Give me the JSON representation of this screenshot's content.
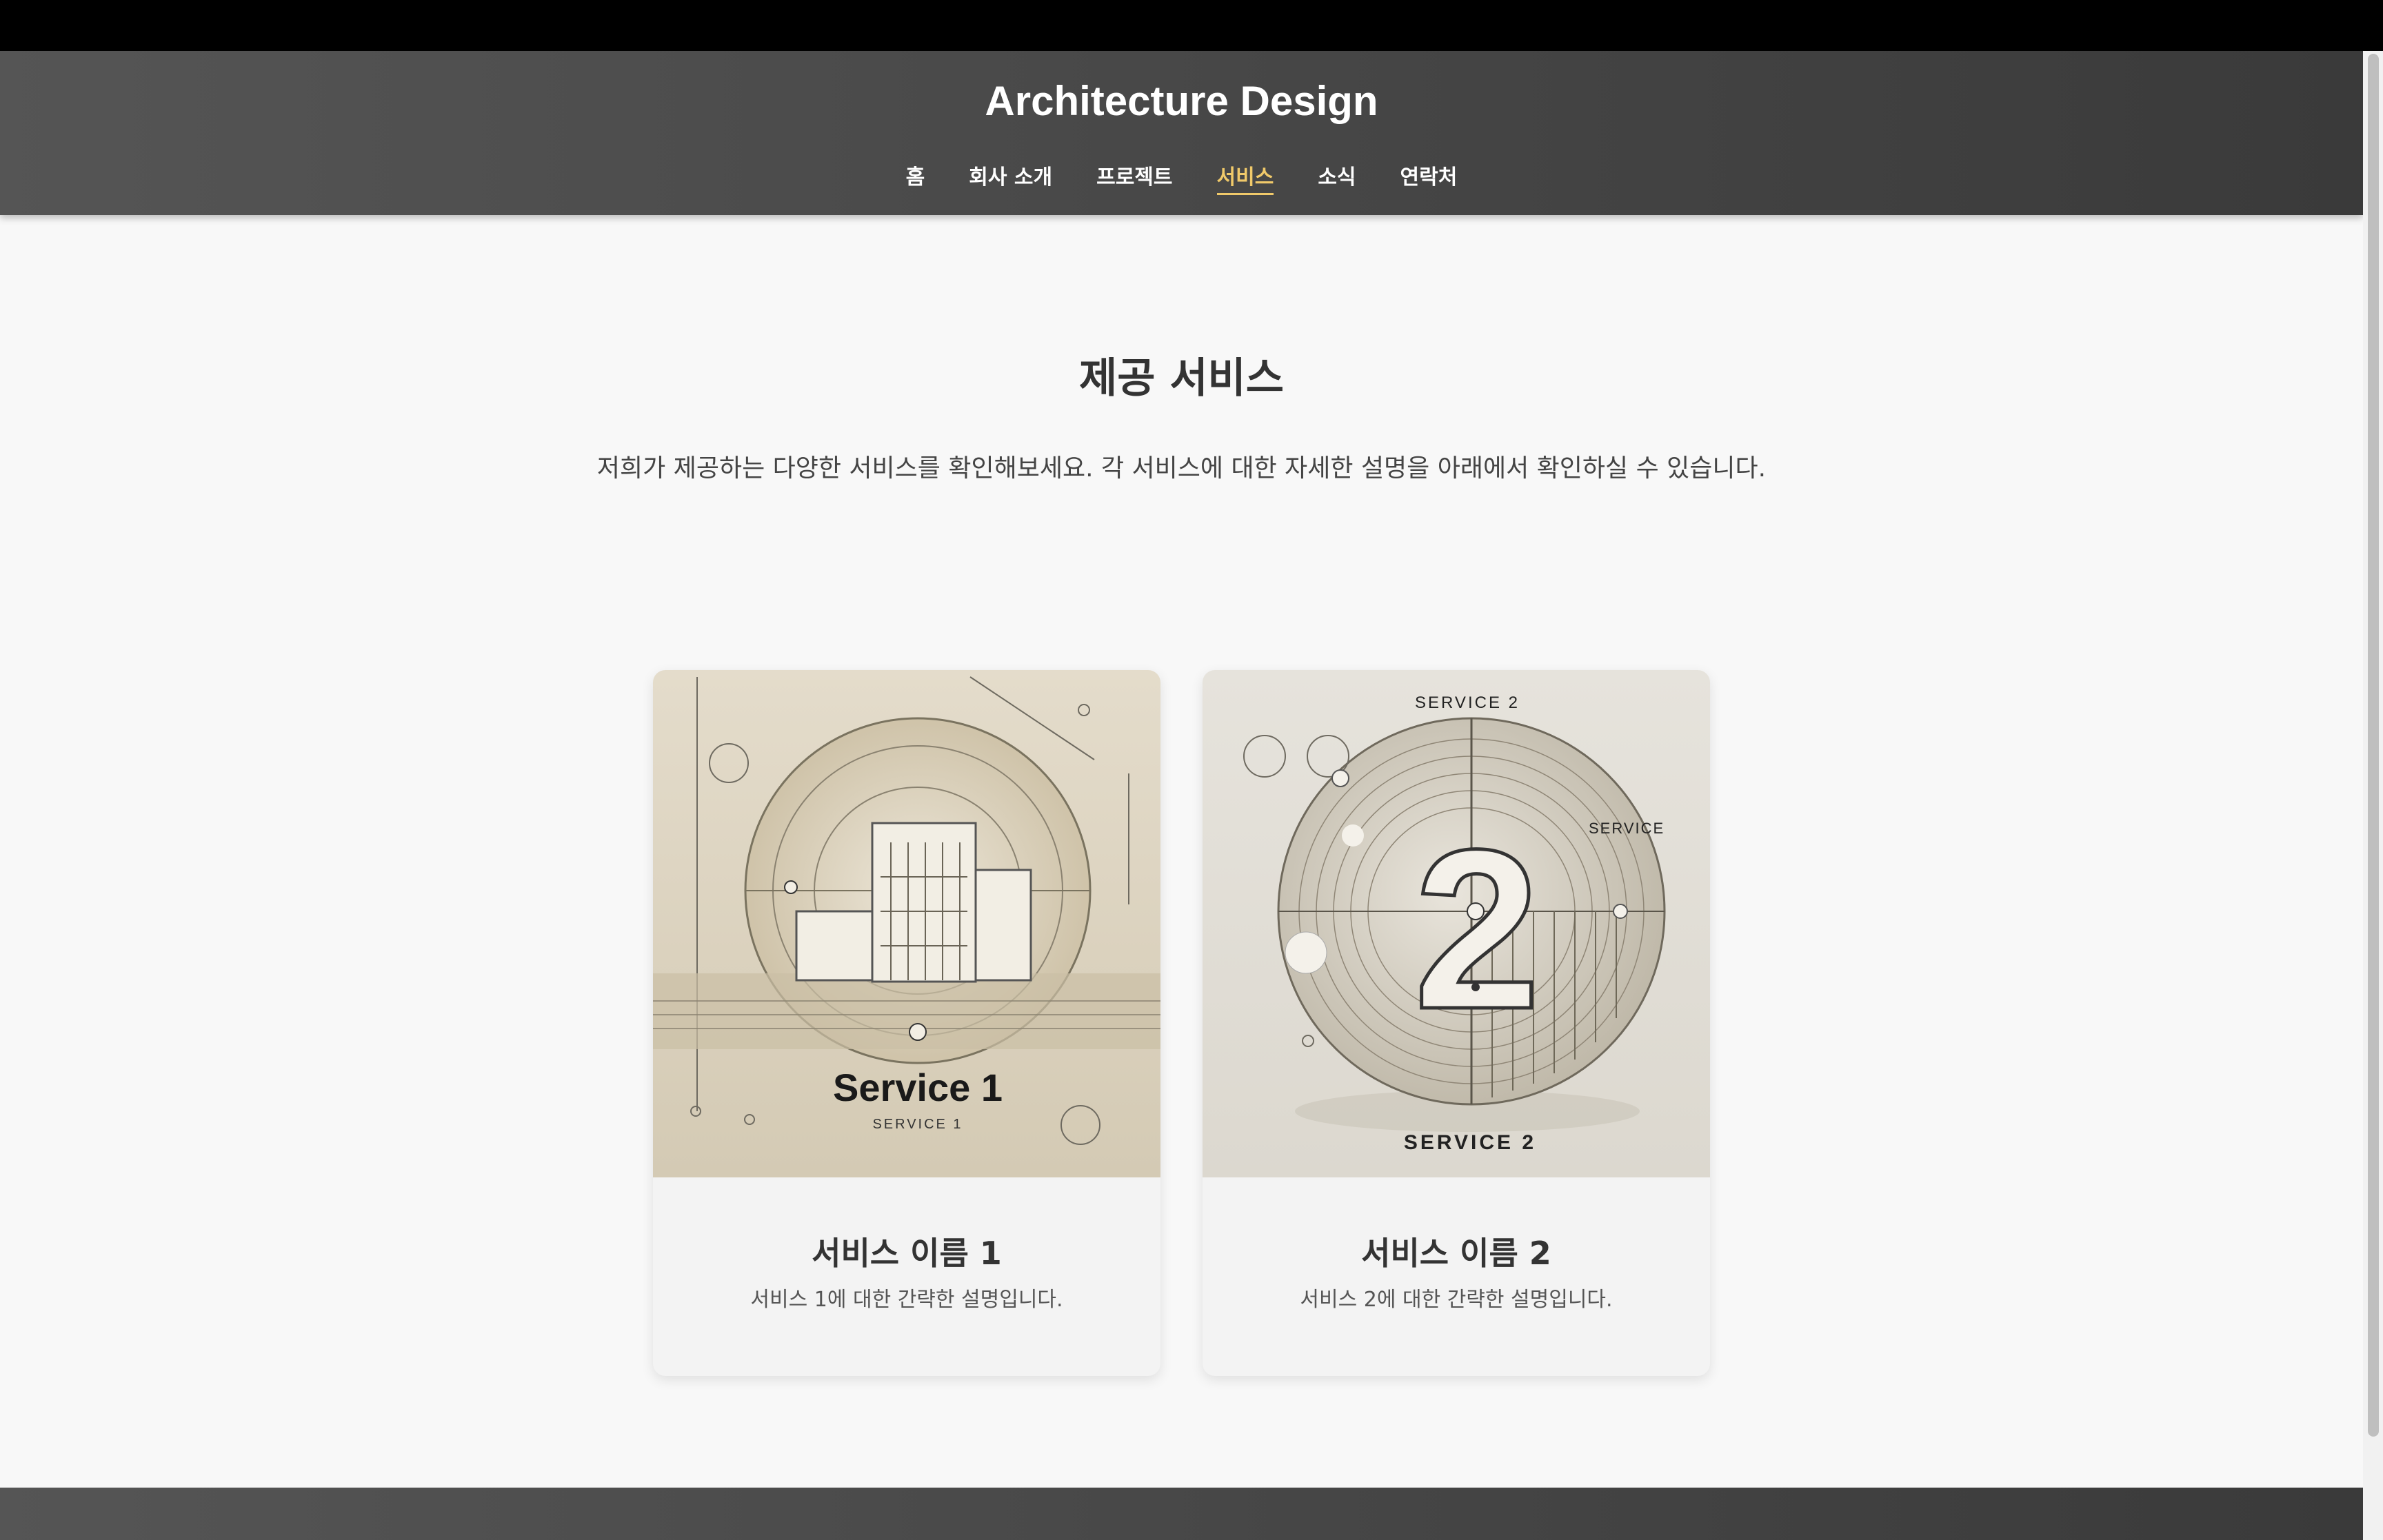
{
  "header": {
    "title": "Architecture Design",
    "nav": [
      {
        "label": "홈"
      },
      {
        "label": "회사 소개"
      },
      {
        "label": "프로젝트"
      },
      {
        "label": "서비스",
        "active": true
      },
      {
        "label": "소식"
      },
      {
        "label": "연락처"
      }
    ]
  },
  "main": {
    "heading": "제공 서비스",
    "description": "저희가 제공하는 다양한 서비스를 확인해보세요. 각 서비스에 대한 자세한 설명을 아래에서 확인하실 수 있습니다.",
    "services": [
      {
        "title": "서비스 이름 1",
        "description": "서비스 1에 대한 간략한 설명입니다.",
        "image_caption": "Service 1",
        "image_subcaption": "SERVICE 1"
      },
      {
        "title": "서비스 이름 2",
        "description": "서비스 2에 대한 간략한 설명입니다.",
        "image_top_label": "SERVICE 2",
        "image_side_label": "SERVICE",
        "image_numeral": "2",
        "image_caption": "SERVICE 2"
      }
    ]
  },
  "colors": {
    "header_bg": "#4a4a4a",
    "active_nav": "#f0c96a",
    "page_bg": "#f8f8f8",
    "card_bg": "#f3f3f3"
  }
}
